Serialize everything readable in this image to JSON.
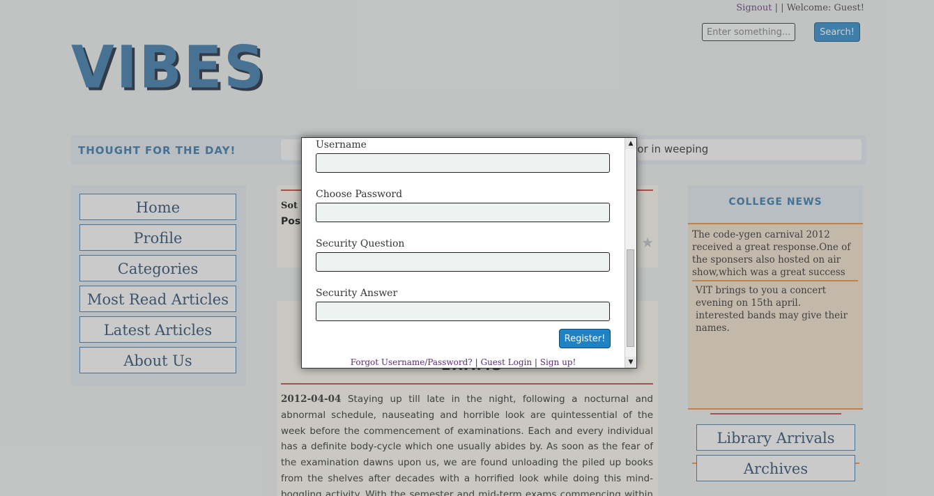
{
  "header": {
    "signout_label": "Signout",
    "separator": "| |",
    "welcome_text": "Welcome: Guest!",
    "search": {
      "placeholder": "Enter something...",
      "button_label": "Search!"
    },
    "logo_text": "VIBES"
  },
  "thought": {
    "label": "THOUGHT FOR THE DAY!",
    "text_visible": "g or in weeping"
  },
  "sidebar": {
    "items": [
      {
        "label": "Home"
      },
      {
        "label": "Profile"
      },
      {
        "label": "Categories"
      },
      {
        "label": "Most Read Articles"
      },
      {
        "label": "Latest Articles"
      },
      {
        "label": "About Us"
      }
    ]
  },
  "main": {
    "card_lines": [
      "Sot",
      "Pos"
    ],
    "article": {
      "title_partial": "EXAMS",
      "date": "2012-04-04",
      "body": "Staying up till late in the night, following a nocturnal and abnormal schedule, nauseating and horrible look are quintessential of the week before the commencement of examinations. Each and every individual has a definite body-cycle which one usually abides by. As soon as the fear of the examination dawns upon us, we are found unloading the piled up books from the shelves after decades with a horrified look while doing this mind-boggling activity. With the semester and mid-term exams commencing within twenty days a few stress-"
    }
  },
  "news": {
    "title": "COLLEGE NEWS",
    "items": [
      "The code-ygen carnival 2012 received a great response.One of the sponsers also hosted on air show,which was a great success",
      "VIT brings to you a concert evening on 15th april. interested bands may give their names."
    ],
    "buttons": [
      {
        "label": "Library Arrivals"
      },
      {
        "label": "Archives"
      }
    ]
  },
  "modal": {
    "fields": [
      {
        "label": "Username"
      },
      {
        "label": "Choose Password"
      },
      {
        "label": "Security Question"
      },
      {
        "label": "Security Answer"
      }
    ],
    "register_label": "Register!",
    "links": {
      "forgot": "Forgot Username/Password?",
      "guest": "Guest Login",
      "signup": "Sign up!",
      "separator": "|"
    }
  },
  "colors": {
    "accent": "#2f6fa4",
    "button_blue": "#1f82c3",
    "news_border": "#e0893a",
    "rule_red": "#c23b3b"
  }
}
